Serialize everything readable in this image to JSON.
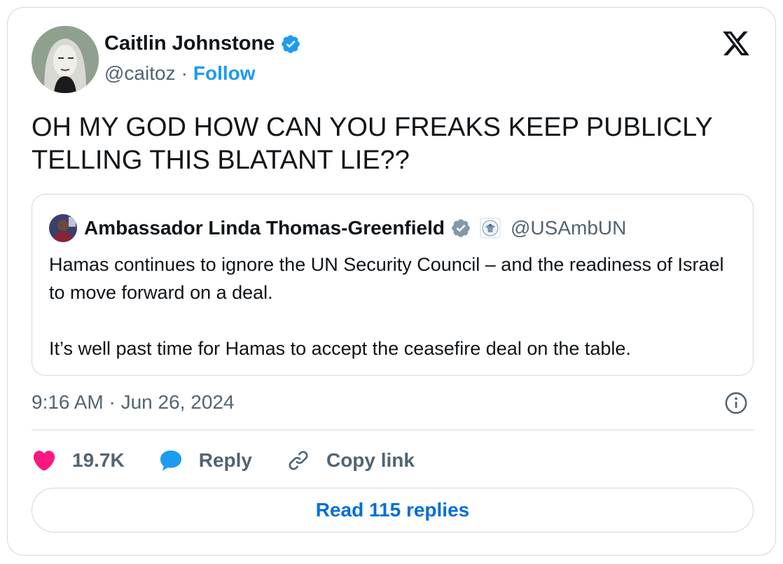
{
  "tweet": {
    "author": {
      "name": "Caitlin Johnstone",
      "handle": "@caitoz",
      "separator": "·",
      "follow_label": "Follow",
      "verified": true
    },
    "text": "OH MY GOD HOW CAN YOU FREAKS KEEP PUBLICLY TELLING THIS BLATANT LIE??",
    "quoted": {
      "name": "Ambassador Linda Thomas-Greenfield",
      "handle": "@USAmbUN",
      "verified": true,
      "affiliation_icon": "us-state-department-seal-icon",
      "paragraphs": [
        "Hamas continues to ignore the UN Security Council – and the readiness of Israel to move forward on a deal.",
        "It’s well past time for Hamas to accept the ceasefire deal on the table."
      ]
    },
    "timestamp": "9:16 AM · Jun 26, 2024",
    "actions": {
      "likes": "19.7K",
      "reply_label": "Reply",
      "copy_label": "Copy link"
    },
    "read_replies_label": "Read 115 replies"
  },
  "colors": {
    "accent": "#1d9bf0",
    "link_blue": "#006fd6",
    "like_pink": "#f91880",
    "text_primary": "#0f1419",
    "text_secondary": "#536471",
    "border": "#cfd9de",
    "verified_gray": "#829aab"
  },
  "icons": {
    "brand": "x-logo-icon",
    "verified": "verified-badge-icon",
    "info": "info-icon",
    "like": "heart-icon",
    "reply": "speech-bubble-icon",
    "copy": "link-icon"
  }
}
